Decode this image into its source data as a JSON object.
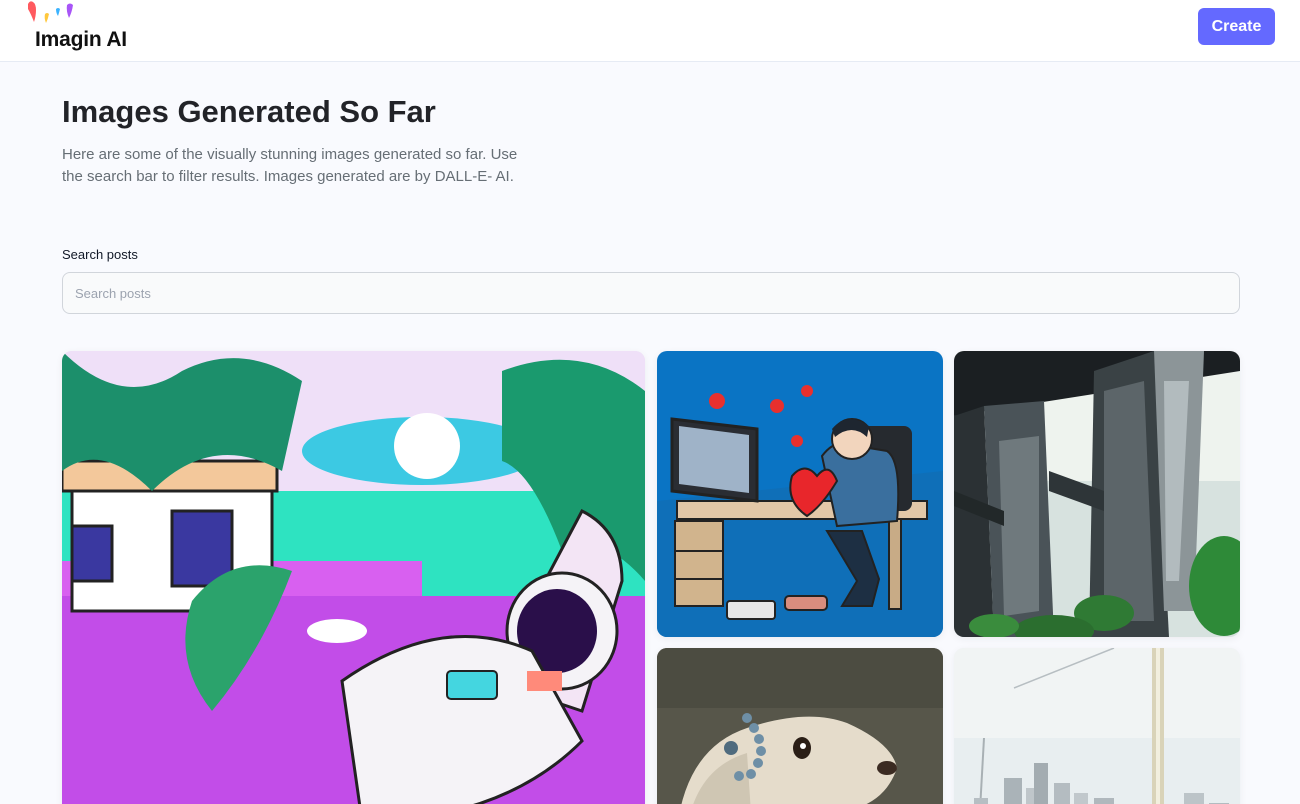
{
  "header": {
    "logo_text": "Imagin AI",
    "create_label": "Create",
    "accent_color": "#6469ff"
  },
  "main": {
    "title": "Images Generated So Far",
    "description": "Here are some of the visually stunning images generated so far. Use the search bar to filter results. Images generated are by DALL-E- AI.",
    "search": {
      "label": "Search posts",
      "placeholder": "Search posts",
      "value": ""
    }
  }
}
